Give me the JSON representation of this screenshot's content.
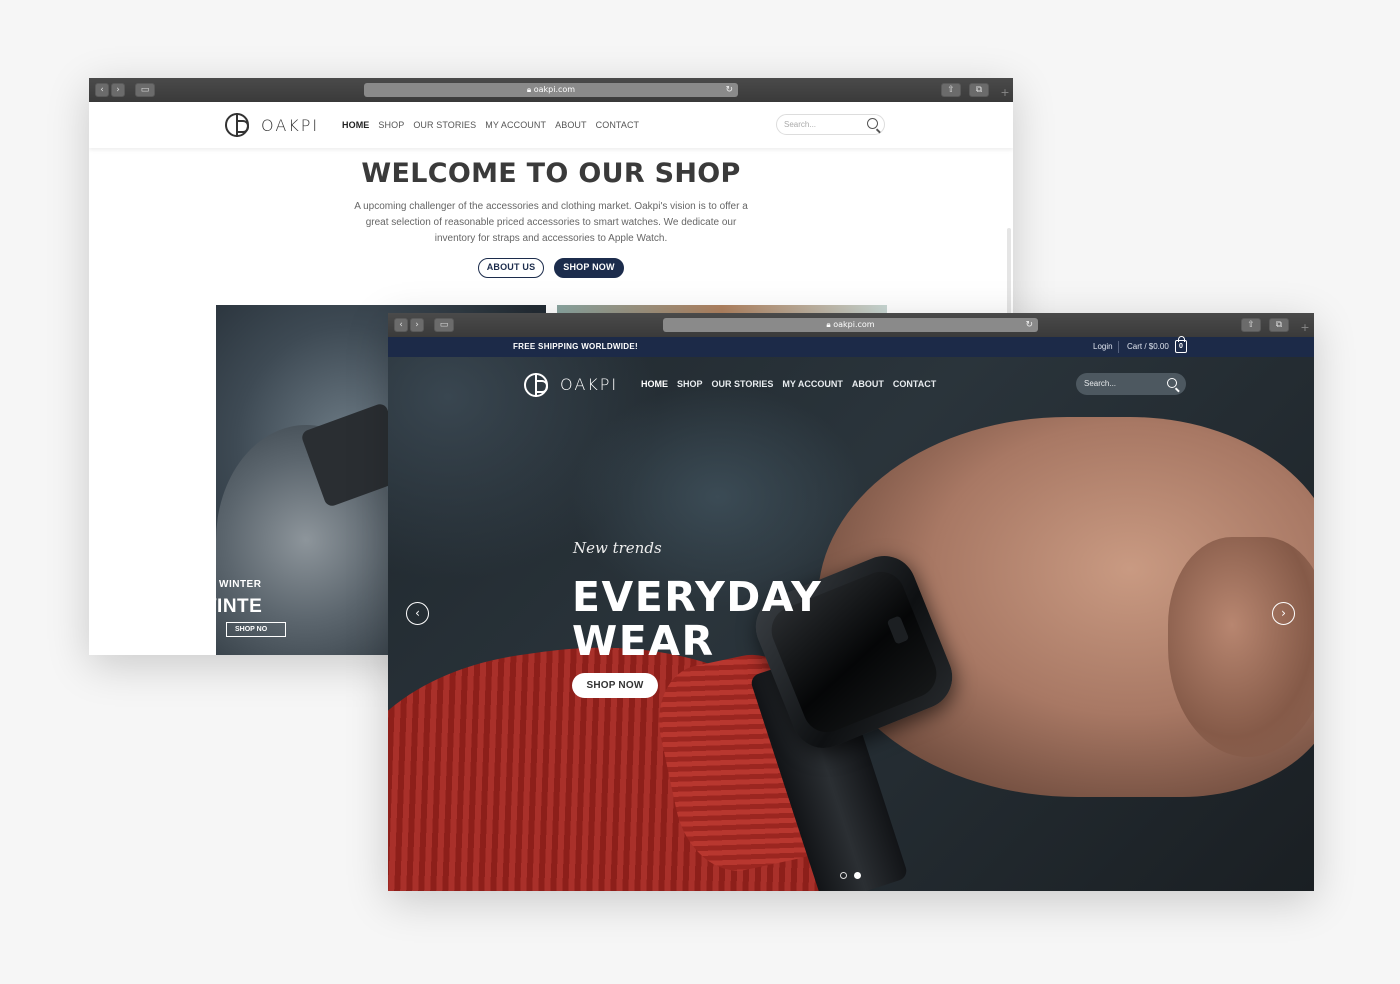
{
  "back_window": {
    "url": "oakpi.com",
    "logo": "OAKPI",
    "nav": [
      "HOME",
      "SHOP",
      "OUR STORIES",
      "MY ACCOUNT",
      "ABOUT",
      "CONTACT"
    ],
    "search_placeholder": "Search...",
    "title": "WELCOME TO OUR SHOP",
    "intro": "A upcoming challenger of the accessories and clothing market. Oakpi's vision is to offer a great selection of reasonable priced accessories to smart watches. We dedicate our inventory for straps and accessories to Apple Watch.",
    "about_button": "ABOUT US",
    "shop_button": "SHOP NOW",
    "promo_small": "WINTER",
    "promo_big": "NEW WINTE",
    "promo_button": "SHOP NO"
  },
  "front_window": {
    "url": "oakpi.com",
    "topbar": {
      "shipping": "FREE SHIPPING WORLDWIDE!",
      "login": "Login",
      "cart": "Cart / $0.00",
      "cart_count": "0"
    },
    "logo": "OAKPI",
    "nav": [
      "HOME",
      "SHOP",
      "OUR STORIES",
      "MY ACCOUNT",
      "ABOUT",
      "CONTACT"
    ],
    "search_placeholder": "Search...",
    "hero": {
      "tagline": "New trends",
      "headline": "EVERYDAY WEAR",
      "button": "SHOP NOW",
      "slides": 2,
      "active_slide": 2
    }
  },
  "colors": {
    "navy": "#1c2a48",
    "button_dark": "#1c2c4c",
    "page_bg": "#f6f6f6"
  },
  "icons": [
    "back-icon",
    "forward-icon",
    "sidebar-icon",
    "lock-icon",
    "reload-icon",
    "share-icon",
    "tabs-icon",
    "new-tab-icon",
    "search-icon",
    "cart-bag-icon",
    "chevron-left-icon",
    "chevron-right-icon"
  ]
}
